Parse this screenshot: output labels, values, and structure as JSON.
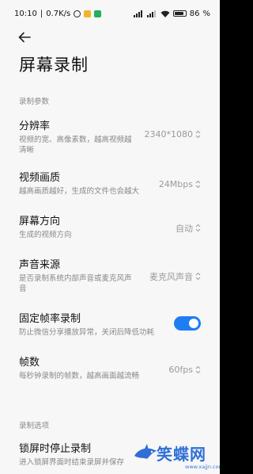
{
  "status_bar": {
    "time": "10:10",
    "net_speed": "0.7K/s",
    "alarm_icon": "alarm-clock-icon",
    "app_icon_colors": [
      "#f0b429",
      "#20b15a"
    ],
    "signal_icon": "signal-icon",
    "wifi_icon": "wifi-icon",
    "battery_level": 0.86,
    "battery_text": "86"
  },
  "header": {
    "back_icon": "arrow-left-icon",
    "title": "屏幕录制"
  },
  "sections": {
    "params_header": "录制参数",
    "options_header": "录制选项"
  },
  "settings": {
    "resolution": {
      "title": "分辨率",
      "desc_line1": "视频的宽、高像素数，越高视频越",
      "desc_line2": "清晰",
      "value": "2340*1080"
    },
    "quality": {
      "title": "视频画质",
      "desc": "越高画质越好，生成的文件也会越大",
      "value": "24Mbps"
    },
    "orientation": {
      "title": "屏幕方向",
      "desc": "生成的视频方向",
      "value": "自动"
    },
    "audio": {
      "title": "声音来源",
      "desc_line1": "是否录制系统内部声音或麦克风声",
      "desc_line2": "音",
      "value": "麦克风声音"
    },
    "fixed_fps": {
      "title": "固定帧率录制",
      "desc": "防止微信分享播放异常，关闭后降低功耗",
      "enabled": true
    },
    "fps": {
      "title": "帧数",
      "desc": "每秒钟录制的帧数，越高画面越流畅",
      "value": "60fps"
    },
    "lock_stop": {
      "title": "锁屏时停止录制",
      "desc": "进入锁屏界面时结束录屏并保存"
    }
  },
  "watermark": {
    "text": "笑蝶网",
    "url": "www.xajjn.com"
  },
  "colors": {
    "accent": "#1e7df2",
    "background": "#f7f7f7"
  }
}
